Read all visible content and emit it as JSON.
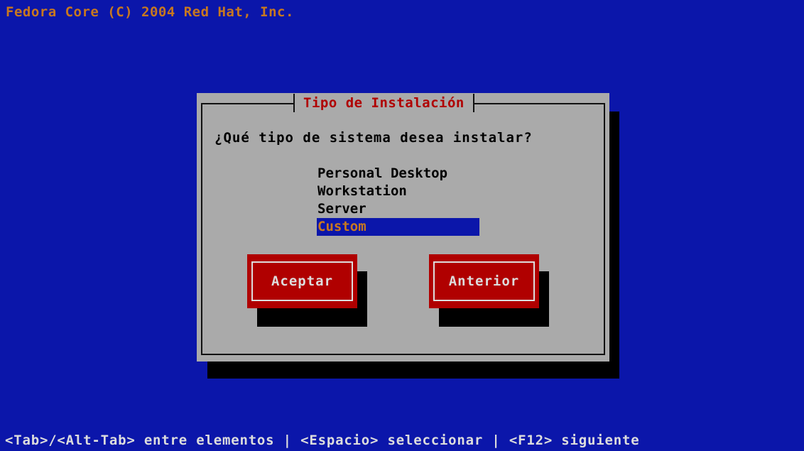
{
  "header": {
    "title": "Fedora Core (C) 2004 Red Hat, Inc."
  },
  "dialog": {
    "title": "Tipo de Instalación",
    "question": "¿Qué tipo de sistema desea instalar?",
    "options": [
      {
        "label": "Personal Desktop",
        "selected": false
      },
      {
        "label": "Workstation",
        "selected": false
      },
      {
        "label": "Server",
        "selected": false
      },
      {
        "label": "Custom",
        "selected": true
      }
    ],
    "buttons": {
      "accept": "Aceptar",
      "back": "Anterior"
    }
  },
  "footer": {
    "help": "<Tab>/<Alt-Tab> entre elementos | <Espacio> seleccionar | <F12> siguiente"
  },
  "colors": {
    "background": "#0b16aa",
    "dialog": "#aaaaaa",
    "button": "#b00000",
    "highlight_text": "#c8781f"
  }
}
